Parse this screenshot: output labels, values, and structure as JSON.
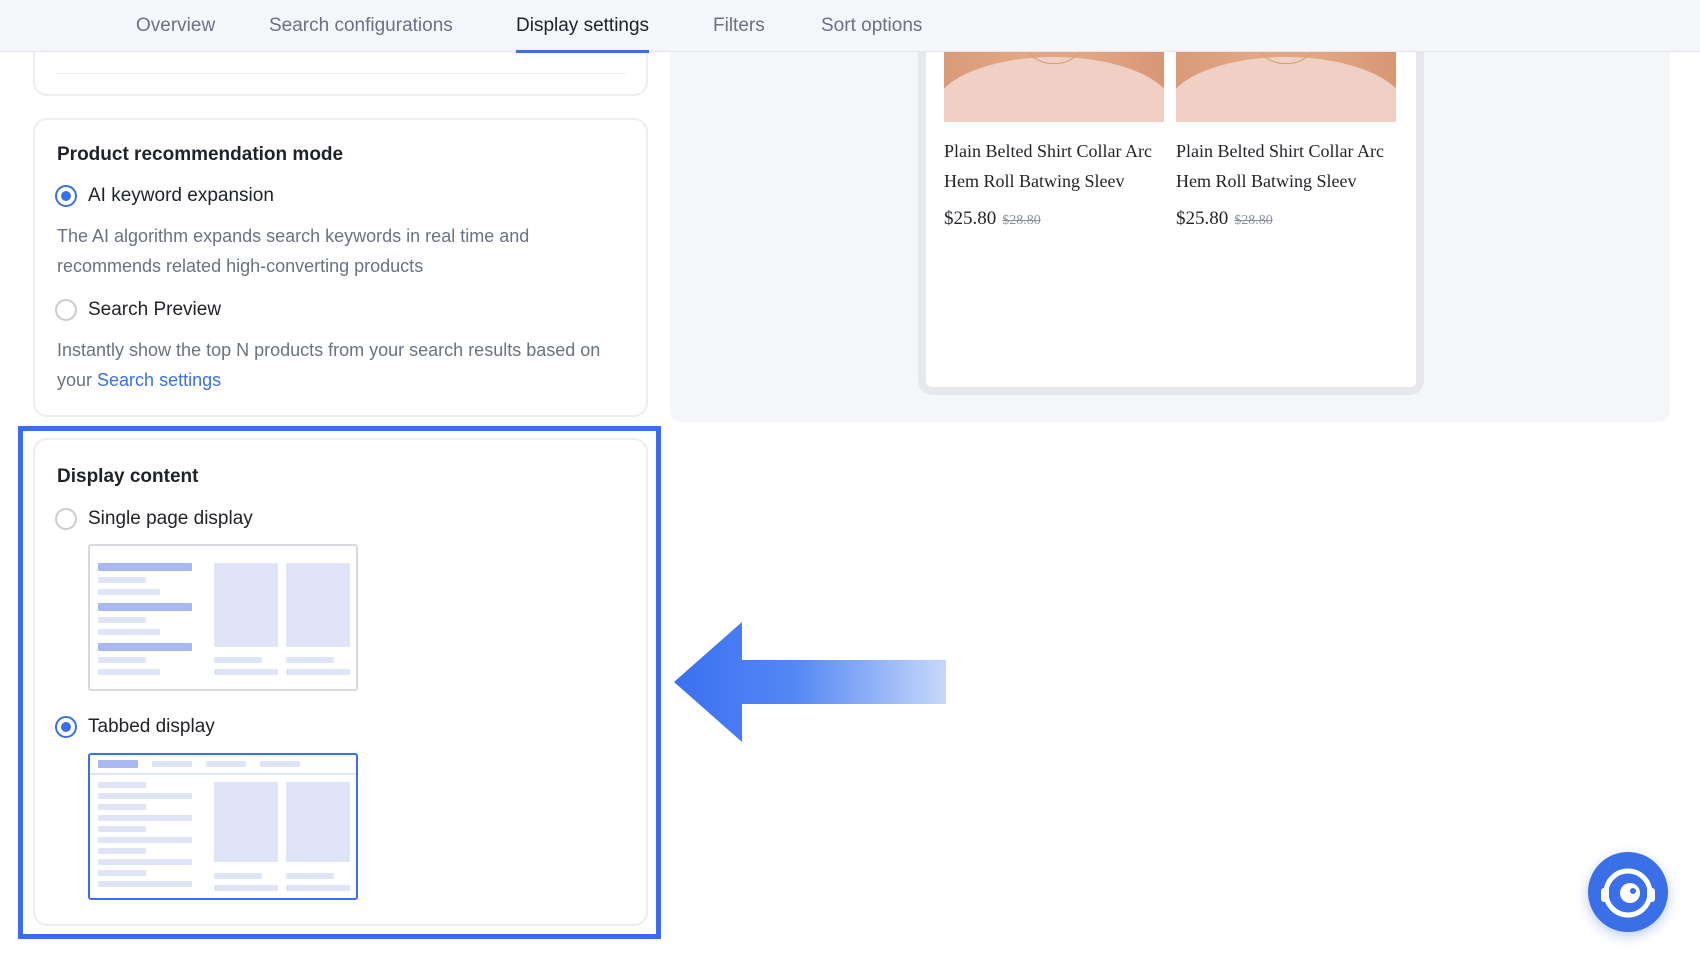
{
  "tabs": [
    {
      "label": "Overview"
    },
    {
      "label": "Search configurations"
    },
    {
      "label": "Display settings",
      "active": true
    },
    {
      "label": "Filters"
    },
    {
      "label": "Sort options"
    }
  ],
  "recommendation": {
    "title": "Product recommendation mode",
    "options": [
      {
        "label": "AI keyword expansion",
        "checked": true,
        "desc": "The AI algorithm expands search keywords in real time and recommends related high-converting products"
      },
      {
        "label": "Search Preview",
        "checked": false,
        "desc_prefix": "Instantly show the top N products from your search results based on your ",
        "desc_link": "Search settings"
      }
    ]
  },
  "display_content": {
    "title": "Display content",
    "options": [
      {
        "label": "Single page display",
        "checked": false
      },
      {
        "label": "Tabbed display",
        "checked": true
      }
    ]
  },
  "preview": {
    "products": [
      {
        "name_line1": "Plain Belted Shirt Collar Arc",
        "name_line2": "Hem Roll Batwing Sleev",
        "price": "$25.80",
        "old_price": "$28.80"
      },
      {
        "name_line1": "Plain Belted Shirt Collar Arc",
        "name_line2": "Hem Roll Batwing Sleev",
        "price": "$25.80",
        "old_price": "$28.80"
      }
    ]
  },
  "colors": {
    "accent": "#3b6fe8",
    "highlight": "#3a6cf0"
  },
  "icons": {
    "support": "customer-support-headset-icon",
    "arrow": "arrow-left-icon"
  }
}
